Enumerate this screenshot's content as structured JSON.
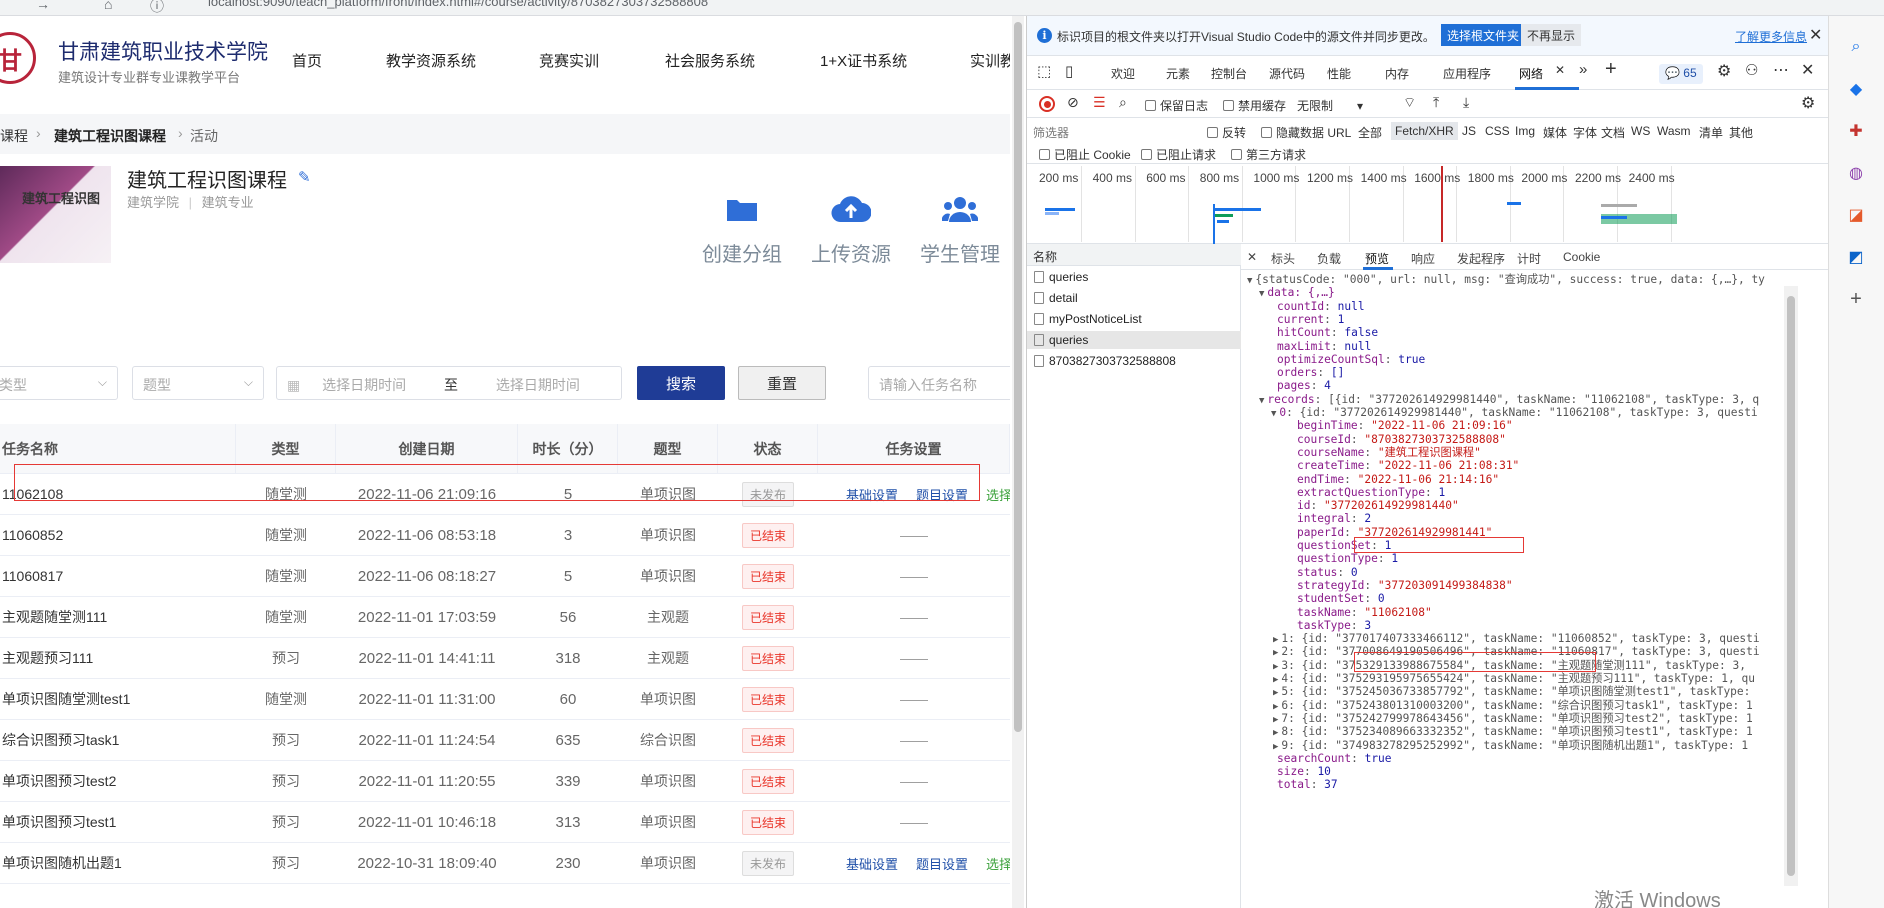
{
  "browser": {
    "url": "localhost:9090/teach_platform/front/index.html#/course/activity/8703827303732588808"
  },
  "header": {
    "school_name": "甘肃建筑职业技术学院",
    "school_sub": "建筑设计专业群专业课教学平台",
    "nav": [
      "首页",
      "教学资源系统",
      "竞赛实训",
      "社会服务系统",
      "1+X证书系统",
      "实训教"
    ]
  },
  "breadcrumb": [
    "课程",
    "建筑工程识图课程",
    "活动"
  ],
  "course": {
    "title": "建筑工程识图课程",
    "college": "建筑学院",
    "major": "建筑专业",
    "cover_text": "建筑工程识图",
    "actions": [
      "创建分组",
      "上传资源",
      "学生管理"
    ]
  },
  "filters": {
    "type_placeholder": "类型",
    "qtype_placeholder": "题型",
    "date_start_placeholder": "选择日期时间",
    "date_sep": "至",
    "date_end_placeholder": "选择日期时间",
    "search_label": "搜索",
    "reset_label": "重置",
    "task_search_placeholder": "请输入任务名称"
  },
  "table": {
    "headers": [
      "任务名称",
      "类型",
      "创建日期",
      "时长（分）",
      "题型",
      "状态",
      "任务设置"
    ],
    "rows": [
      {
        "name": "11062108",
        "type": "随堂测",
        "date": "2022-11-06 21:09:16",
        "duration": "5",
        "qtype": "单项识图",
        "status": "未发布",
        "status_kind": "gray",
        "settings": [
          "基础设置",
          "题目设置",
          "选择学"
        ]
      },
      {
        "name": "11060852",
        "type": "随堂测",
        "date": "2022-11-06 08:53:18",
        "duration": "3",
        "qtype": "单项识图",
        "status": "已结束",
        "status_kind": "red",
        "settings": []
      },
      {
        "name": "11060817",
        "type": "随堂测",
        "date": "2022-11-06 08:18:27",
        "duration": "5",
        "qtype": "单项识图",
        "status": "已结束",
        "status_kind": "red",
        "settings": []
      },
      {
        "name": "主观题随堂测111",
        "type": "随堂测",
        "date": "2022-11-01 17:03:59",
        "duration": "56",
        "qtype": "主观题",
        "status": "已结束",
        "status_kind": "red",
        "settings": []
      },
      {
        "name": "主观题预习111",
        "type": "预习",
        "date": "2022-11-01 14:41:11",
        "duration": "318",
        "qtype": "主观题",
        "status": "已结束",
        "status_kind": "red",
        "settings": []
      },
      {
        "name": "单项识图随堂测test1",
        "type": "随堂测",
        "date": "2022-11-01 11:31:00",
        "duration": "60",
        "qtype": "单项识图",
        "status": "已结束",
        "status_kind": "red",
        "settings": []
      },
      {
        "name": "综合识图预习task1",
        "type": "预习",
        "date": "2022-11-01 11:24:54",
        "duration": "635",
        "qtype": "综合识图",
        "status": "已结束",
        "status_kind": "red",
        "settings": []
      },
      {
        "name": "单项识图预习test2",
        "type": "预习",
        "date": "2022-11-01 11:20:55",
        "duration": "339",
        "qtype": "单项识图",
        "status": "已结束",
        "status_kind": "red",
        "settings": []
      },
      {
        "name": "单项识图预习test1",
        "type": "预习",
        "date": "2022-11-01 10:46:18",
        "duration": "313",
        "qtype": "单项识图",
        "status": "已结束",
        "status_kind": "red",
        "settings": []
      },
      {
        "name": "单项识图随机出题1",
        "type": "预习",
        "date": "2022-10-31 18:09:40",
        "duration": "230",
        "qtype": "单项识图",
        "status": "未发布",
        "status_kind": "gray",
        "settings": [
          "基础设置",
          "题目设置",
          "选择学"
        ]
      }
    ],
    "empty_setting": "——"
  },
  "devtools": {
    "infobar": {
      "text": "标识项目的根文件夹以打开Visual Studio Code中的源文件并同步更改。",
      "open_btn": "选择根文件夹",
      "hide_btn": "不再显示",
      "learn_more": "了解更多信息"
    },
    "tabs": [
      "欢迎",
      "元素",
      "控制台",
      "源代码",
      "性能",
      "内存",
      "应用程序",
      "网络"
    ],
    "issues_count": "65",
    "toolbar": {
      "preserve_log": "保留日志",
      "disable_cache": "禁用缓存",
      "throttle": "无限制"
    },
    "filter": {
      "placeholder": "筛选器",
      "invert": "反转",
      "hide_data_urls": "隐藏数据 URL",
      "types": [
        "全部",
        "Fetch/XHR",
        "JS",
        "CSS",
        "Img",
        "媒体",
        "字体",
        "文档",
        "WS",
        "Wasm",
        "清单",
        "其他"
      ],
      "blocked_cookies": "已阻止 Cookie",
      "blocked_requests": "已阻止请求",
      "third_party": "第三方请求"
    },
    "timeline_ticks": [
      "200 ms",
      "400 ms",
      "600 ms",
      "800 ms",
      "1000 ms",
      "1200 ms",
      "1400 ms",
      "1600 ms",
      "1800 ms",
      "2000 ms",
      "2200 ms",
      "2400 ms"
    ],
    "name_header": "名称",
    "requests": [
      "queries",
      "detail",
      "myPostNoticeList",
      "queries",
      "8703827303732588808"
    ],
    "selected_request": 3,
    "detail_tabs": [
      "标头",
      "负载",
      "预览",
      "响应",
      "发起程序",
      "计时",
      "Cookie"
    ],
    "detail_active": "预览",
    "preview": {
      "summary": "{statusCode: \"000\", url: null, msg: \"查询成功\", success: true, data: {,…}, ty",
      "data_label": "data: {,…}",
      "fields": [
        [
          "countId",
          "null"
        ],
        [
          "current",
          "1"
        ],
        [
          "hitCount",
          "false"
        ],
        [
          "maxLimit",
          "null"
        ],
        [
          "optimizeCountSql",
          "true"
        ],
        [
          "orders",
          "[]"
        ],
        [
          "pages",
          "4"
        ]
      ],
      "records_summary": "[{id: \"377202614929981440\", taskName: \"11062108\", taskType: 3, q",
      "record0_summary": "{id: \"377202614929981440\", taskName: \"11062108\", taskType: 3, questi",
      "record0": [
        [
          "beginTime",
          "\"2022-11-06 21:09:16\""
        ],
        [
          "courseId",
          "\"8703827303732588808\""
        ],
        [
          "courseName",
          "\"建筑工程识图课程\""
        ],
        [
          "createTime",
          "\"2022-11-06 21:08:31\""
        ],
        [
          "endTime",
          "\"2022-11-06 21:14:16\""
        ],
        [
          "extractQuestionType",
          "1"
        ],
        [
          "id",
          "\"377202614929981440\""
        ],
        [
          "integral",
          "2"
        ],
        [
          "paperId",
          "\"377202614929981441\""
        ],
        [
          "questionSet",
          "1"
        ],
        [
          "questionType",
          "1"
        ],
        [
          "status",
          "0"
        ],
        [
          "strategyId",
          "\"377203091499384838\""
        ],
        [
          "studentSet",
          "0"
        ],
        [
          "taskName",
          "\"11062108\""
        ],
        [
          "taskType",
          "3"
        ]
      ],
      "other_records": [
        "1: {id: \"377017407333466112\", taskName: \"11060852\", taskType: 3, questi",
        "2: {id: \"377008649190506496\", taskName: \"11060817\", taskType: 3, questi",
        "3: {id: \"375329133988675584\", taskName: \"主观题随堂测111\", taskType: 3, ",
        "4: {id: \"375293195975655424\", taskName: \"主观题预习111\", taskType: 1, qu",
        "5: {id: \"375245036733857792\", taskName: \"单项识图随堂测test1\", taskType:",
        "6: {id: \"375243801310003200\", taskName: \"综合识图预习task1\", taskType: 1",
        "7: {id: \"375242799978643456\", taskName: \"单项识图预习test2\", taskType: 1",
        "8: {id: \"375234089663332352\", taskName: \"单项识图预习test1\", taskType: 1",
        "9: {id: \"374983278295252992\", taskName: \"单项识图随机出题1\", taskType: 1"
      ],
      "tail": [
        [
          "searchCount",
          "true"
        ],
        [
          "size",
          "10"
        ],
        [
          "total",
          "37"
        ]
      ]
    }
  },
  "watermark": "激活 Windows",
  "colors": {
    "primary": "#1f3c96",
    "brand": "#b8243a",
    "status_red": "#e9352a",
    "highlight": "#e53935",
    "link": "#1f4fa8"
  }
}
